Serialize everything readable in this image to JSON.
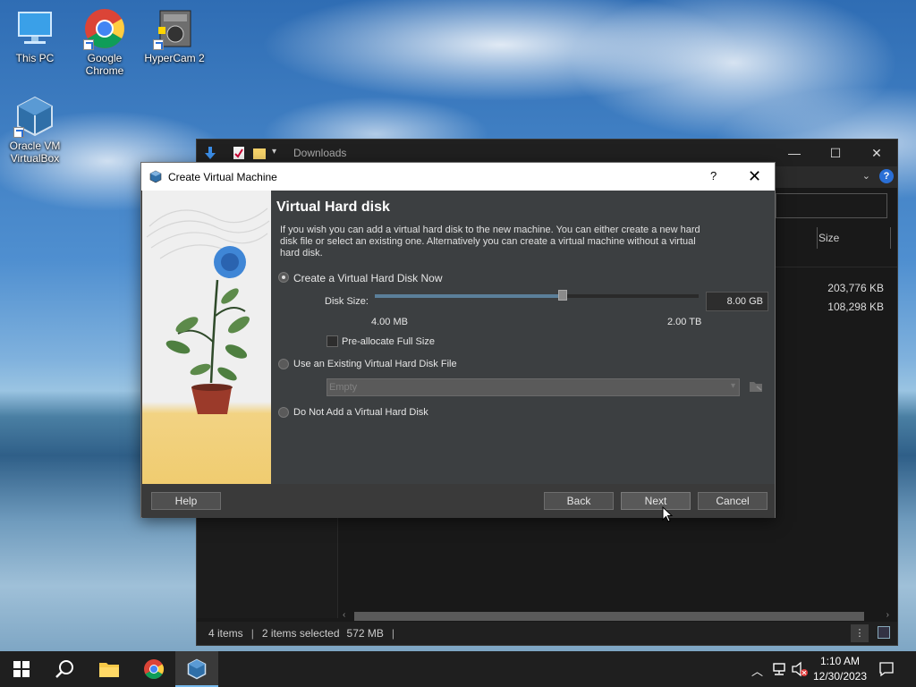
{
  "desktop": {
    "icons": [
      {
        "label": "This PC",
        "icon": "monitor-icon"
      },
      {
        "label": "Google Chrome",
        "icon": "chrome-icon"
      },
      {
        "label": "HyperCam 2",
        "icon": "hypercam-icon"
      },
      {
        "label": "Oracle VM VirtualBox",
        "icon": "virtualbox-icon"
      }
    ]
  },
  "explorer": {
    "title": "Downloads",
    "column_size": "Size",
    "rows": [
      {
        "size": "203,776 KB"
      },
      {
        "size": "108,298 KB"
      }
    ],
    "status": {
      "items": "4 items",
      "selected": "2 items selected",
      "selected_size": "572 MB"
    }
  },
  "dialog": {
    "title": "Create Virtual Machine",
    "help_glyph": "?",
    "close_glyph": "✕",
    "heading": "Virtual Hard disk",
    "description": "If you wish you can add a virtual hard disk to the new machine. You can either create a new hard disk file or select an existing one. Alternatively you can create a virtual machine without a virtual hard disk.",
    "option_create": "Create a Virtual Hard Disk Now",
    "disk_size_label": "Disk Size:",
    "disk_size_value": "8.00 GB",
    "disk_size_fraction": 0.58,
    "slider_min": "4.00 MB",
    "slider_max": "2.00 TB",
    "preallocate_label": "Pre-allocate Full Size",
    "preallocate_checked": false,
    "option_existing": "Use an Existing Virtual Hard Disk File",
    "existing_placeholder": "Empty",
    "option_none": "Do Not Add a Virtual Hard Disk",
    "selected_option": "create",
    "buttons": {
      "help": "Help",
      "back": "Back",
      "next": "Next",
      "cancel": "Cancel"
    }
  },
  "taskbar": {
    "time": "1:10 AM",
    "date": "12/30/2023"
  },
  "colors": {
    "dialog_bg": "#3c3f41",
    "taskbar_bg": "#1f1f1f",
    "accent": "#76b9ed"
  }
}
